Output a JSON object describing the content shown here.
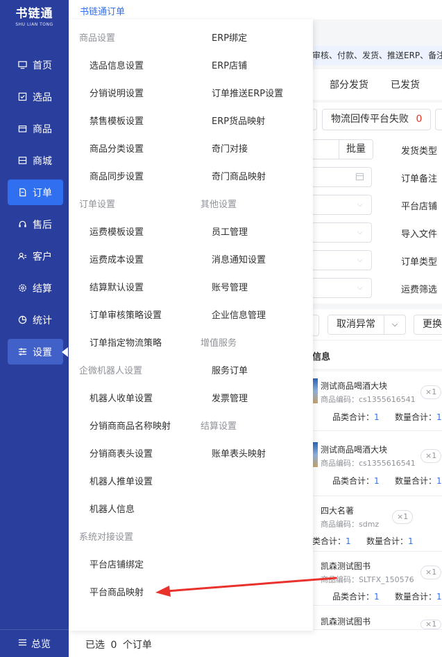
{
  "sidebar": {
    "logo_title": "书链通",
    "logo_sub": "SHU LIAN TONG",
    "items": [
      {
        "label": "首页"
      },
      {
        "label": "选品"
      },
      {
        "label": "商品"
      },
      {
        "label": "商城"
      },
      {
        "label": "订单"
      },
      {
        "label": "售后"
      },
      {
        "label": "客户"
      },
      {
        "label": "结算"
      },
      {
        "label": "统计"
      },
      {
        "label": "设置"
      }
    ],
    "bottom_label": "总览"
  },
  "header": {
    "title": "书链通订单"
  },
  "background": {
    "notice": "审核、付款、发货、推送ERP、备注",
    "tabs": [
      "部分发货",
      "已发货"
    ],
    "logistics_fail": {
      "label": "物流回传平台失败",
      "count": "0"
    },
    "batch_button": "批量",
    "filter_labels": [
      "发货类型",
      "订单备注",
      "平台店铺",
      "导入文件",
      "订单类型",
      "运费筛选"
    ],
    "cancel_exception": "取消异常",
    "more_button": "更换",
    "list_header": "信息",
    "products": [
      {
        "name": "测试商品喝酒大块",
        "code": "商品编码：cs1355616541",
        "qty": "×1",
        "category_total": "品类合计：",
        "category_value": "1",
        "qty_total": "数量合计：",
        "qty_value": "1"
      },
      {
        "name": "测试商品喝酒大块",
        "code": "商品编码：cs1355616541",
        "qty": "×1",
        "category_total": "品类合计：",
        "category_value": "1",
        "qty_total": "数量合计：",
        "qty_value": "1"
      },
      {
        "name": "四大名著",
        "code": "商品编码：sdmz",
        "qty": "×1",
        "category_total": "类合计：",
        "category_value": "1",
        "qty_total": "数量合计：",
        "qty_value": "1"
      },
      {
        "name": "凯森测试图书",
        "code": "商品编码：SLTFX_150576",
        "qty": "×1",
        "category_total": "品类合计：",
        "category_value": "1",
        "qty_total": "数量合计：",
        "qty_value": "1"
      },
      {
        "name": "凯森测试图书",
        "code": "",
        "qty": "×1"
      }
    ],
    "footer": {
      "selected_prefix": "已选",
      "selected_count": "0",
      "selected_suffix": "个订单"
    }
  },
  "menu": {
    "left": [
      {
        "heading": "商品设置",
        "items": [
          "选品信息设置",
          "分销说明设置",
          "禁售模板设置",
          "商品分类设置",
          "商品同步设置"
        ]
      },
      {
        "heading": "订单设置",
        "items": [
          "运费模板设置",
          "运费成本设置",
          "结算默认设置",
          "订单审核策略设置",
          "订单指定物流策略"
        ]
      },
      {
        "heading": "企微机器人设置",
        "items": [
          "机器人收单设置",
          "分销商商品名称映射",
          "分销商表头设置",
          "机器人推单设置",
          "机器人信息"
        ]
      },
      {
        "heading": "系统对接设置",
        "items": [
          "平台店铺绑定",
          "平台商品映射"
        ]
      }
    ],
    "right": [
      {
        "heading": "ERP绑定",
        "items": [
          "ERP店铺",
          "订单推送ERP设置",
          "ERP货品映射",
          "奇门对接",
          "奇门商品映射"
        ]
      },
      {
        "heading": "其他设置",
        "items": [
          "员工管理",
          "消息通知设置",
          "账号管理",
          "企业信息管理"
        ]
      },
      {
        "heading": "增值服务",
        "items": [
          "服务订单",
          "发票管理"
        ]
      },
      {
        "heading": "结算设置",
        "items": [
          "账单表头映射"
        ]
      }
    ]
  },
  "colors": {
    "sidebar": "#2a3f9d",
    "active": "#2f6ff0",
    "arrow": "#e8322b"
  }
}
